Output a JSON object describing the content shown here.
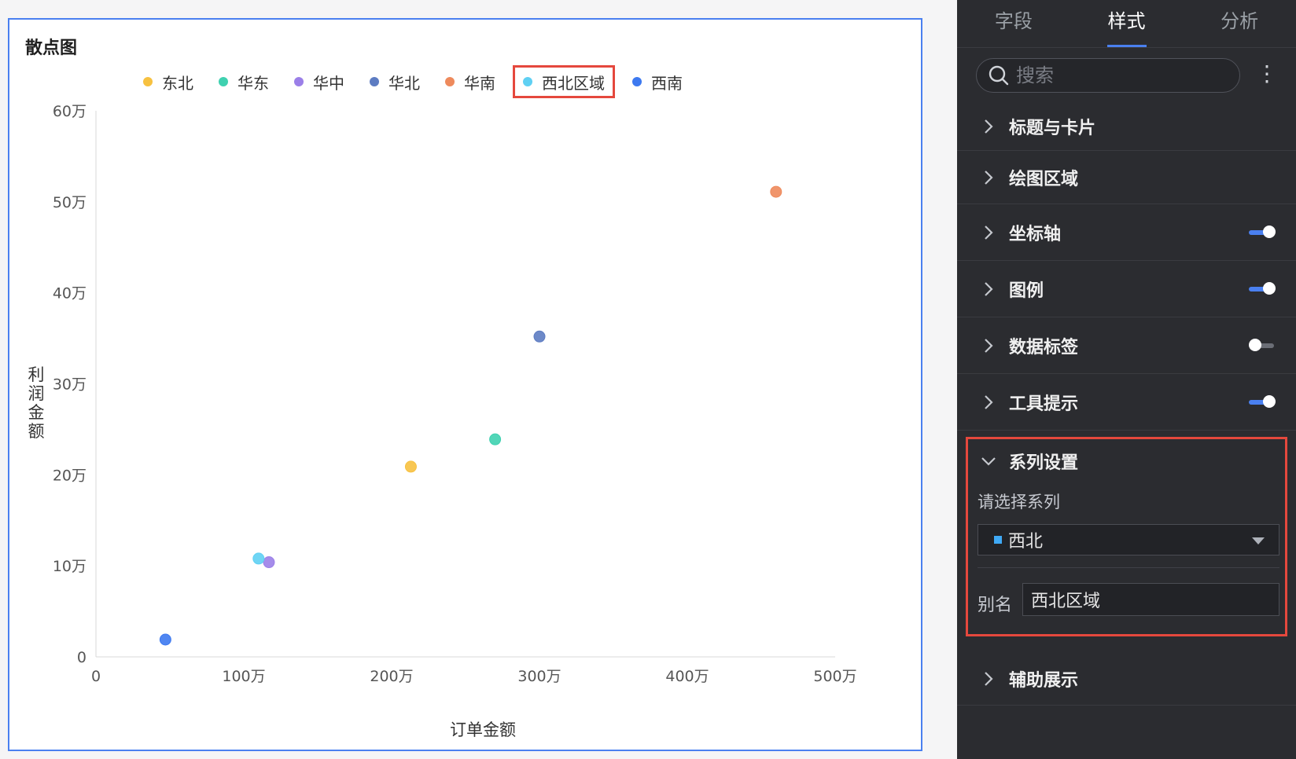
{
  "chart": {
    "title": "散点图",
    "legend": [
      {
        "name": "东北",
        "color": "#f7c140"
      },
      {
        "name": "华东",
        "color": "#3fd1b0"
      },
      {
        "name": "华中",
        "color": "#9b7fe8"
      },
      {
        "name": "华北",
        "color": "#5d7cc2"
      },
      {
        "name": "华南",
        "color": "#ee8a5c"
      },
      {
        "name": "西北区域",
        "color": "#5fd0f3",
        "selected": true
      },
      {
        "name": "西南",
        "color": "#3d79f0"
      }
    ],
    "xlabel": "订单金额",
    "ylabel": "利润金额"
  },
  "chart_data": {
    "type": "scatter",
    "title": "散点图",
    "xlabel": "订单金额",
    "ylabel": "利润金额",
    "xlim": [
      0,
      5000000
    ],
    "ylim": [
      0,
      600000
    ],
    "x_ticks": [
      "0",
      "100万",
      "200万",
      "300万",
      "400万",
      "500万"
    ],
    "y_ticks": [
      "0",
      "10万",
      "20万",
      "30万",
      "40万",
      "50万",
      "60万"
    ],
    "legend_position": "top",
    "series": [
      {
        "name": "东北",
        "color": "#f7c140",
        "points": [
          {
            "x": 2130000,
            "y": 209000
          }
        ]
      },
      {
        "name": "华东",
        "color": "#3fd1b0",
        "points": [
          {
            "x": 2700000,
            "y": 239000
          }
        ]
      },
      {
        "name": "华中",
        "color": "#9b7fe8",
        "points": [
          {
            "x": 1170000,
            "y": 104000
          }
        ]
      },
      {
        "name": "华北",
        "color": "#5d7cc2",
        "points": [
          {
            "x": 3000000,
            "y": 352000
          }
        ]
      },
      {
        "name": "华南",
        "color": "#ee8a5c",
        "points": [
          {
            "x": 4600000,
            "y": 511000
          }
        ]
      },
      {
        "name": "西北区域",
        "color": "#5fd0f3",
        "points": [
          {
            "x": 1100000,
            "y": 108000
          }
        ]
      },
      {
        "name": "西南",
        "color": "#3d79f0",
        "points": [
          {
            "x": 470000,
            "y": 19000
          }
        ]
      }
    ]
  },
  "panel": {
    "tabs": [
      {
        "label": "字段",
        "active": false
      },
      {
        "label": "样式",
        "active": true
      },
      {
        "label": "分析",
        "active": false
      }
    ],
    "search_placeholder": "搜索",
    "sections": {
      "title_card": "标题与卡片",
      "plot_area": "绘图区域",
      "axis": "坐标轴",
      "legend": "图例",
      "data_label": "数据标签",
      "tooltip": "工具提示",
      "series": "系列设置",
      "aux": "辅助展示"
    },
    "toggles": {
      "axis": true,
      "legend": true,
      "data_label": false,
      "tooltip": true
    },
    "series_settings": {
      "select_label": "请选择系列",
      "selected_series": "西北",
      "selected_color": "#3fa9f5",
      "alias_label": "别名",
      "alias_value": "西北区域"
    }
  }
}
